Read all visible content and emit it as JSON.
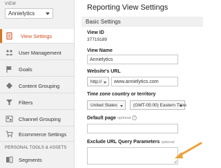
{
  "sidebar": {
    "view_label": "VIEW",
    "view_selected": "Annielytics",
    "items": [
      {
        "label": "View Settings",
        "icon": "document-icon",
        "active": true
      },
      {
        "label": "User Management",
        "icon": "users-icon"
      },
      {
        "label": "Goals",
        "icon": "flag-icon"
      },
      {
        "label": "Content Grouping",
        "icon": "content-grouping-icon"
      },
      {
        "label": "Filters",
        "icon": "filter-icon"
      },
      {
        "label": "Channel Grouping",
        "icon": "channel-grouping-icon"
      },
      {
        "label": "Ecommerce Settings",
        "icon": "cart-icon"
      },
      {
        "label": "Segments",
        "icon": "segments-icon"
      }
    ],
    "section_label": "PERSONAL TOOLS & ASSETS"
  },
  "main": {
    "title": "Reporting View Settings",
    "section": "Basic Settings",
    "view_id_label": "View ID",
    "view_id_value": "37719189",
    "view_name_label": "View Name",
    "view_name_value": "Annielytics",
    "website_url_label": "Website's URL",
    "protocol_value": "http://",
    "website_url_value": "www.annielytics.com",
    "timezone_label": "Time zone country or territory",
    "country_value": "United States",
    "timezone_value": "(GMT-05:00) Eastern Time",
    "default_page_label": "Default page",
    "default_page_optional": "optional",
    "default_page_value": "",
    "help_icon_glyph": "?",
    "exclude_label": "Exclude URL Query Parameters",
    "exclude_optional": "optional",
    "exclude_value": ""
  },
  "colors": {
    "accent": "#e0701c",
    "active_text": "#d04a1a",
    "arrow": "#f0a030"
  }
}
